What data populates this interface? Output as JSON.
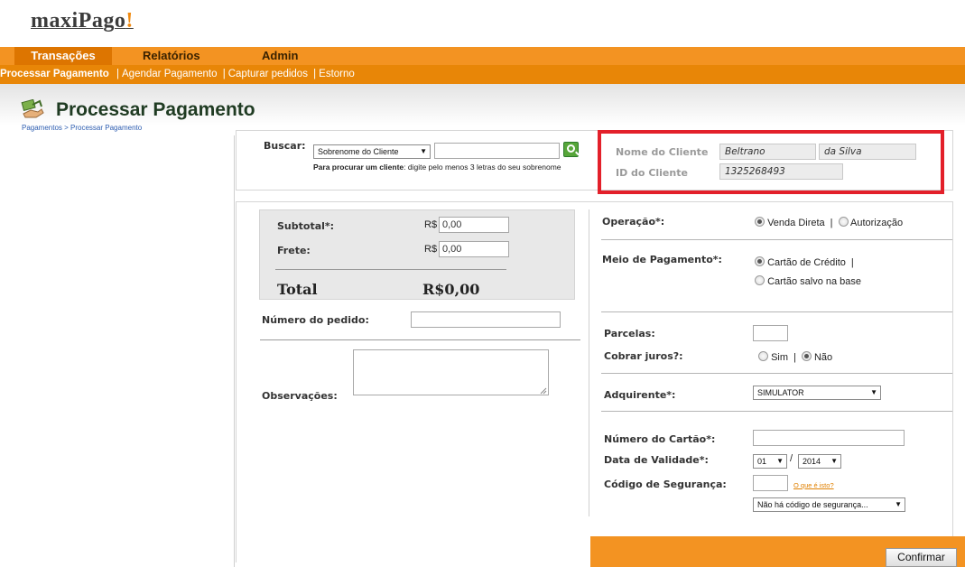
{
  "brand": {
    "logo_text": "maxiPago",
    "logo_bang": "!"
  },
  "nav": {
    "tabs": [
      "Transações",
      "Relatórios",
      "Admin"
    ],
    "active_tab": "Transações",
    "subnav": [
      {
        "label": "Processar Pagamento",
        "current": true
      },
      {
        "label": "Agendar Pagamento"
      },
      {
        "label": "Capturar pedidos"
      },
      {
        "label": "Estorno"
      }
    ],
    "separator": "|"
  },
  "page": {
    "title": "Processar Pagamento",
    "breadcrumb": "Pagamentos > Processar Pagamento",
    "icon": "payment-process-icon"
  },
  "search": {
    "label": "Buscar:",
    "field_select": "Sobrenome do Cliente",
    "value": "",
    "hint_bold": "Para procurar um cliente",
    "hint_rest": ": digite pelo menos 3 letras do seu sobrenome"
  },
  "customer": {
    "name_label": "Nome do Cliente",
    "first_name": "Beltrano",
    "last_name": "da Silva",
    "id_label": "ID do Cliente",
    "id_value": "1325268493"
  },
  "order": {
    "subtotal_label": "Subtotal*:",
    "subtotal_value": "0,00",
    "frete_label": "Frete:",
    "frete_value": "0,00",
    "currency_prefix": "R$",
    "total_label": "Total",
    "total_value": "R$0,00",
    "pedido_label": "Número do pedido:",
    "pedido_value": "",
    "obs_label": "Observações:",
    "obs_value": ""
  },
  "payment": {
    "operacao_label": "Operação*:",
    "operacao_options": [
      "Venda Direta",
      "Autorização"
    ],
    "operacao_selected": "Venda Direta",
    "meio_label": "Meio de Pagamento*:",
    "meio_options": [
      "Cartão de Crédito",
      "Cartão salvo na base"
    ],
    "meio_selected": "Cartão de Crédito",
    "parcelas_label": "Parcelas:",
    "parcelas_value": "",
    "juros_label": "Cobrar juros?:",
    "juros_options": [
      "Sim",
      "Não"
    ],
    "juros_selected": "Não",
    "adquirente_label": "Adquirente*:",
    "adquirente_value": "SIMULATOR",
    "cartao_label": "Número do Cartão*:",
    "cartao_value": "",
    "validade_label": "Data de Validade*:",
    "validade_month": "01",
    "validade_year": "2014",
    "validade_sep": "/",
    "codigo_label": "Código de Segurança:",
    "codigo_value": "",
    "codigo_help": "O que é isto?",
    "codigo_select": "Não há código de segurança..."
  },
  "actions": {
    "confirm_label": "Confirmar"
  },
  "colors": {
    "orange": "#f39322",
    "orange_dark": "#dd7500",
    "highlight_red": "#e3202a",
    "title_green": "#1f3b22"
  }
}
